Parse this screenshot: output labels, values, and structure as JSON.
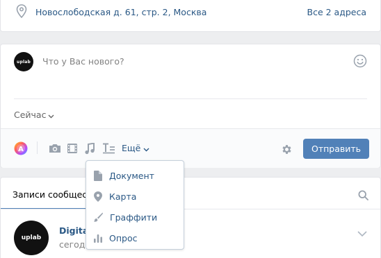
{
  "address_card": {
    "address": "Новослободская д. 61, стр. 2, Москва",
    "all_addresses": "Все 2 адреса"
  },
  "composer": {
    "avatar_text": "uplab",
    "placeholder": "Что у Вас нового?",
    "publish_time": "Сейчас",
    "more_label": "Ещё",
    "send_label": "Отправить",
    "toolbar_icons": [
      "color-poster-icon",
      "camera-icon",
      "video-icon",
      "music-icon",
      "text-article-icon",
      "gear-icon"
    ]
  },
  "more_menu": {
    "items": [
      {
        "label": "Документ",
        "icon": "document-icon"
      },
      {
        "label": "Карта",
        "icon": "map-pin-icon"
      },
      {
        "label": "Граффити",
        "icon": "brush-icon"
      },
      {
        "label": "Опрос",
        "icon": "poll-icon"
      }
    ]
  },
  "posts": {
    "tab_label": "Записи сообщества",
    "author": "Digital",
    "date": "сегодня",
    "avatar_text": "uplab"
  },
  "colors": {
    "accent": "#5181b8",
    "link": "#2a5885",
    "background": "#edeef0"
  }
}
